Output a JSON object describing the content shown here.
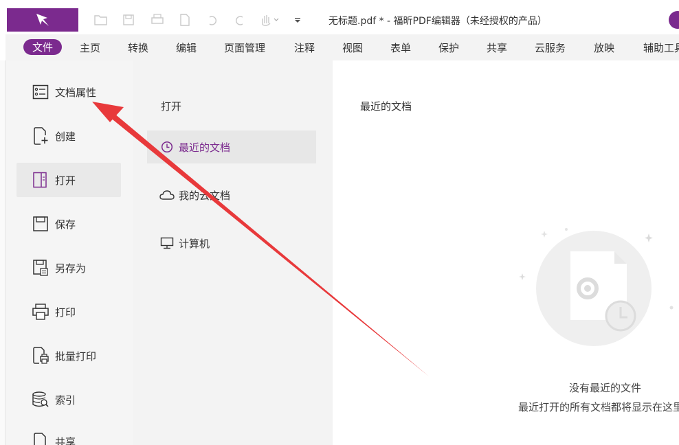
{
  "window": {
    "title": "无标题.pdf * - 福昕PDF编辑器（未经授权的产品）"
  },
  "menu": {
    "items": [
      "文件",
      "主页",
      "转换",
      "编辑",
      "页面管理",
      "注释",
      "视图",
      "表单",
      "保护",
      "共享",
      "云服务",
      "放映",
      "辅助工具"
    ]
  },
  "leftnav": {
    "items": [
      "文档属性",
      "创建",
      "打开",
      "保存",
      "另存为",
      "打印",
      "批量打印",
      "索引",
      "共享"
    ]
  },
  "open_panel": {
    "title": "打开",
    "sources": [
      "最近的文档",
      "我的云文档",
      "计算机"
    ]
  },
  "recent": {
    "title": "最近的文档",
    "empty_title": "没有最近的文件",
    "empty_hint": "最近打开的所有文档都将显示在这里"
  },
  "colors": {
    "accent": "#7b2a8e",
    "annotation_arrow": "#e8393b"
  }
}
